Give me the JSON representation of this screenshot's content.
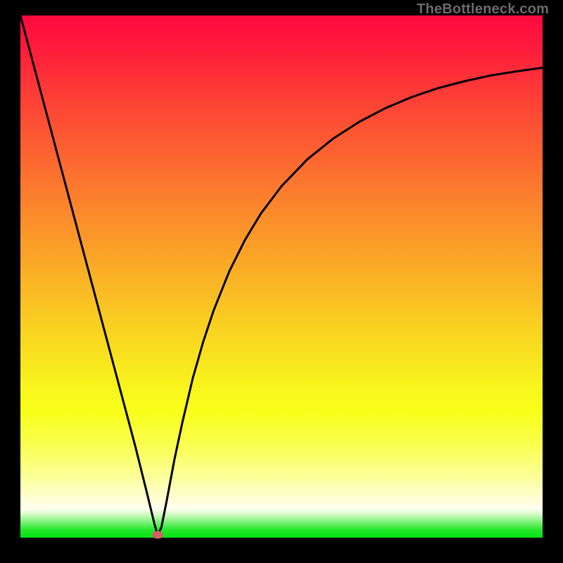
{
  "watermark": "TheBottleneck.com",
  "marker_color": "#cf6363",
  "chart_data": {
    "type": "line",
    "title": "",
    "xlabel": "",
    "ylabel": "",
    "xlim": [
      0,
      100
    ],
    "ylim": [
      0,
      100
    ],
    "grid": false,
    "legend": false,
    "background_gradient": {
      "stops": [
        {
          "pos": 0.0,
          "color": "#fe093e"
        },
        {
          "pos": 0.06,
          "color": "#fe1b3c"
        },
        {
          "pos": 0.16,
          "color": "#fd4036"
        },
        {
          "pos": 0.27,
          "color": "#fc6531"
        },
        {
          "pos": 0.38,
          "color": "#fb8a2b"
        },
        {
          "pos": 0.49,
          "color": "#faae26"
        },
        {
          "pos": 0.6,
          "color": "#f9d221"
        },
        {
          "pos": 0.72,
          "color": "#f8f71c"
        },
        {
          "pos": 0.76,
          "color": "#f8ff1a"
        },
        {
          "pos": 0.82,
          "color": "#f9ff4d"
        },
        {
          "pos": 0.88,
          "color": "#fbff94"
        },
        {
          "pos": 0.93,
          "color": "#feffdb"
        },
        {
          "pos": 0.945,
          "color": "#feffef"
        },
        {
          "pos": 0.955,
          "color": "#d7fbc8"
        },
        {
          "pos": 0.97,
          "color": "#7ef179"
        },
        {
          "pos": 0.985,
          "color": "#26e72c"
        },
        {
          "pos": 1.0,
          "color": "#03e312"
        }
      ]
    },
    "series": [
      {
        "name": "curve",
        "color": "#000000",
        "x": [
          0,
          2,
          4,
          6,
          8,
          10,
          12,
          14,
          16,
          18,
          20,
          22,
          24,
          25.7,
          26.3,
          27,
          28,
          29.5,
          31,
          33,
          35,
          37,
          40,
          43,
          46,
          50,
          55,
          60,
          65,
          70,
          75,
          80,
          85,
          90,
          95,
          100
        ],
        "y": [
          100,
          92.5,
          85,
          77.5,
          70,
          62.5,
          55,
          47.5,
          40,
          32.5,
          25,
          17.5,
          9.5,
          2.5,
          0.5,
          2,
          7,
          15,
          22,
          30.5,
          37.5,
          43.5,
          51,
          57,
          62,
          67.3,
          72.5,
          76.5,
          79.7,
          82.3,
          84.4,
          86.1,
          87.4,
          88.5,
          89.3,
          90
        ]
      }
    ],
    "marker": {
      "x": 26.3,
      "y": 0.5
    }
  }
}
